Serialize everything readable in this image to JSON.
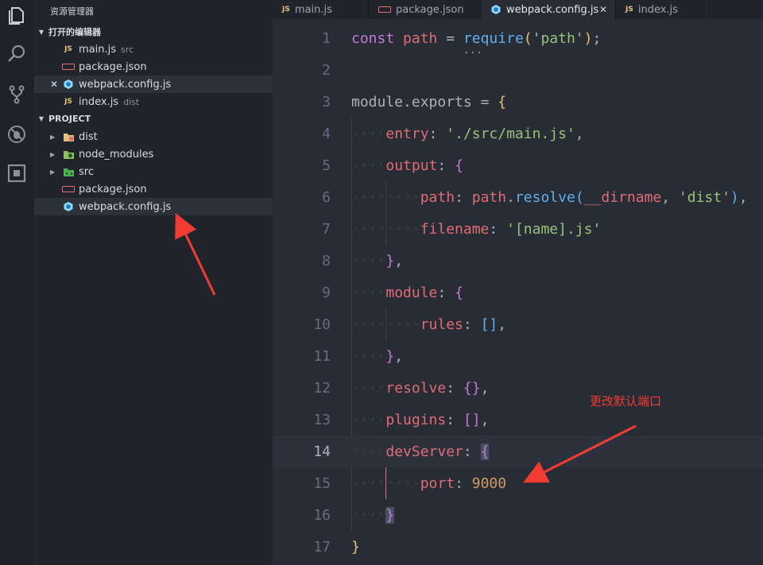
{
  "sidebar": {
    "title": "资源管理器",
    "open_editors_label": "打开的编辑器",
    "open_editors": [
      {
        "name": "main.js",
        "desc": "src",
        "icon": "js"
      },
      {
        "name": "package.json",
        "desc": "",
        "icon": "package"
      },
      {
        "name": "webpack.config.js",
        "desc": "",
        "icon": "webpack"
      },
      {
        "name": "index.js",
        "desc": "dist",
        "icon": "js"
      }
    ],
    "project_label": "PROJECT",
    "project_items": [
      {
        "name": "dist",
        "icon": "folder-dist"
      },
      {
        "name": "node_modules",
        "icon": "folder-node"
      },
      {
        "name": "src",
        "icon": "folder-src"
      },
      {
        "name": "package.json",
        "icon": "package"
      },
      {
        "name": "webpack.config.js",
        "icon": "webpack"
      }
    ]
  },
  "tabs": [
    {
      "label": "main.js",
      "icon": "js"
    },
    {
      "label": "package.json",
      "icon": "package"
    },
    {
      "label": "webpack.config.js",
      "icon": "webpack",
      "active": true
    },
    {
      "label": "index.js",
      "icon": "js"
    }
  ],
  "editor": {
    "current_line": 14,
    "lines": [
      "1",
      "2",
      "3",
      "4",
      "5",
      "6",
      "7",
      "8",
      "9",
      "10",
      "11",
      "12",
      "13",
      "14",
      "15",
      "16",
      "17"
    ],
    "code": {
      "l1_kw": "const",
      "l1_var": "path",
      "l1_fn": "require",
      "l1_str": "'path'",
      "l3_obj": "module",
      "l3_prop": "exports",
      "l4_key": "entry",
      "l4_str": "'./src/main.js'",
      "l5_key": "output",
      "l6_key": "path",
      "l6_obj": "path",
      "l6_fn": "resolve",
      "l6_var": "__dirname",
      "l6_str": "'dist'",
      "l7_key": "filename",
      "l7_str": "'[name].js'",
      "l9_key": "module",
      "l10_key": "rules",
      "l12_key": "resolve",
      "l13_key": "plugins",
      "l14_key": "devServer",
      "l15_key": "port",
      "l15_num": "9000"
    }
  },
  "annotation": {
    "text": "更改默认端口",
    "color": "#f03c33"
  }
}
